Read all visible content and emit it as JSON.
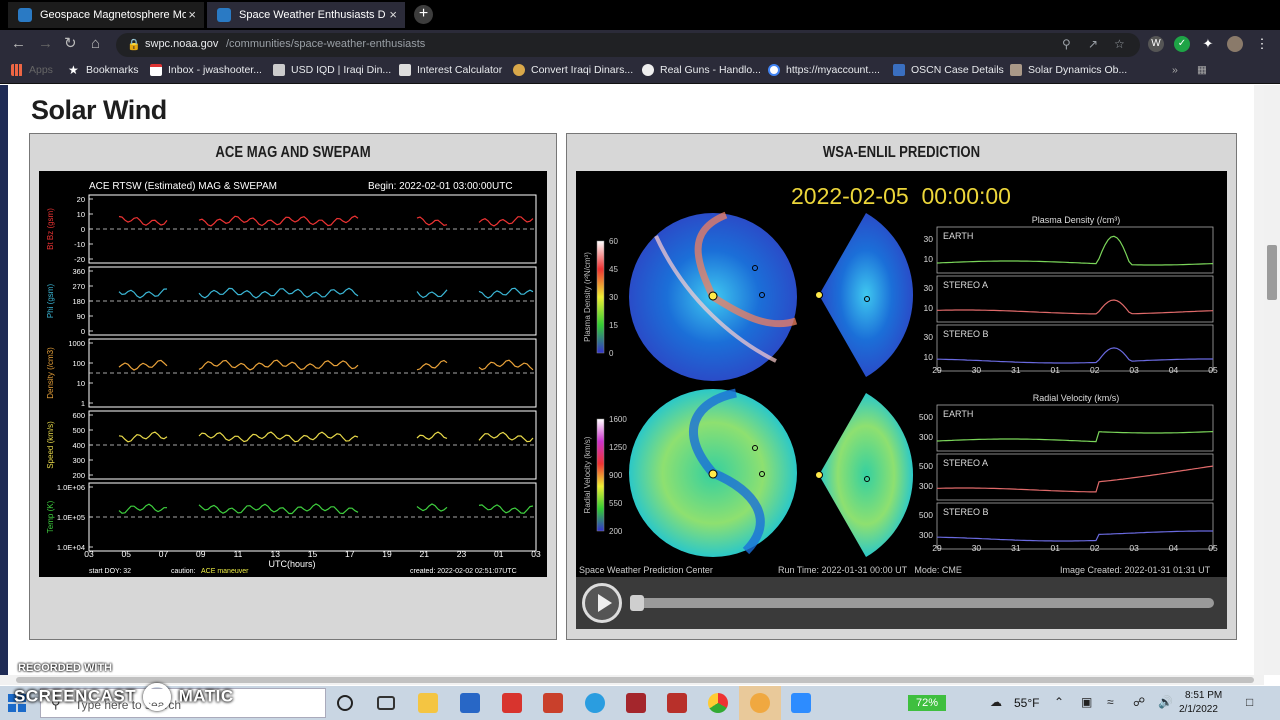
{
  "browser": {
    "tabs": [
      {
        "title": "Geospace Magnetosphere Movi",
        "close": "×"
      },
      {
        "title": "Space Weather Enthusiasts Dash",
        "close": "×"
      }
    ],
    "new_tab": "+",
    "url_host": "swpc.noaa.gov",
    "url_path": "/communities/space-weather-enthusiasts",
    "bookmarks": [
      {
        "label": "Apps",
        "icon": "apps-grid-icon"
      },
      {
        "label": "Bookmarks",
        "icon": "star-icon"
      },
      {
        "label": "Inbox - jwashooter...",
        "icon": "gmail-icon"
      },
      {
        "label": "USD IQD | Iraqi Din...",
        "icon": "currency-icon"
      },
      {
        "label": "Interest Calculator",
        "icon": "calculator-icon"
      },
      {
        "label": "Convert Iraqi Dinars...",
        "icon": "convert-icon"
      },
      {
        "label": "Real Guns - Handlo...",
        "icon": "globe-icon"
      },
      {
        "label": "https://myaccount....",
        "icon": "google-icon"
      },
      {
        "label": "OSCN Case Details",
        "icon": "oscn-icon"
      },
      {
        "label": "Solar Dynamics Ob...",
        "icon": "sdo-icon"
      }
    ]
  },
  "page": {
    "section_title": "Solar Wind",
    "left_panel": {
      "title": "ACE MAG AND SWEPAM",
      "plot": {
        "header": "ACE RTSW (Estimated) MAG & SWEPAM",
        "begin": "Begin: 2022-02-01 03:00:00UTC",
        "rows": [
          {
            "label": "Bt Bz (gsm)",
            "ticks": [
              "20",
              "10",
              "0",
              "-10",
              "-20"
            ]
          },
          {
            "label": "Phi (gsm)",
            "ticks": [
              "360",
              "270",
              "180",
              "90",
              "0"
            ]
          },
          {
            "label": "Density (/cm3)",
            "ticks": [
              "1000",
              "100",
              "10",
              "1"
            ]
          },
          {
            "label": "Speed (km/s)",
            "ticks": [
              "600",
              "500",
              "400",
              "300",
              "200"
            ]
          },
          {
            "label": "Temp (K)",
            "ticks": [
              "1.0E+06",
              "1.0E+05",
              "1.0E+04"
            ]
          }
        ],
        "x_ticks": [
          "03",
          "05",
          "07",
          "09",
          "11",
          "13",
          "15",
          "17",
          "19",
          "21",
          "23",
          "01",
          "03"
        ],
        "x_label": "UTC(hours)",
        "footer_left": "start DOY: 32",
        "footer_caution": "caution:",
        "footer_caution_val": "ACE maneuver",
        "footer_right": "created: 2022-02-02 02:51:07UTC"
      }
    },
    "right_panel": {
      "title": "WSA-ENLIL PREDICTION",
      "timestamp": "2022-02-05  00:00:00",
      "density_scale_label": "Plasma Density (r²N/cm³)",
      "density_scale_ticks": [
        "60",
        "45",
        "30",
        "15",
        "0"
      ],
      "velocity_scale_label": "Radial Velocity (km/s)",
      "velocity_scale_ticks": [
        "1600",
        "1250",
        "900",
        "550",
        "200"
      ],
      "density_chart_title": "Plasma Density (/cm³)",
      "velocity_chart_title": "Radial Velocity (km/s)",
      "probes": [
        "EARTH",
        "STEREO A",
        "STEREO B"
      ],
      "density_ticks": [
        "30",
        "10"
      ],
      "velocity_ticks": [
        "500",
        "300"
      ],
      "x_ticks": [
        "29",
        "30",
        "31",
        "01",
        "02",
        "03",
        "04",
        "05"
      ],
      "footer_left": "Space Weather Prediction Center",
      "footer_mid": "Run Time: 2022-01-31 00:00 UT   Mode: CME",
      "footer_right": "Image Created: 2022-01-31 01:31 UT",
      "player_progress": 0.0
    }
  },
  "taskbar": {
    "search_placeholder": "Type here to search",
    "battery": "72%",
    "weather": "55°F",
    "time": "8:51 PM",
    "date": "2/1/2022"
  },
  "watermark": {
    "top": "RECORDED WITH",
    "main": "SCREENCAST",
    "suffix": "MATIC"
  }
}
